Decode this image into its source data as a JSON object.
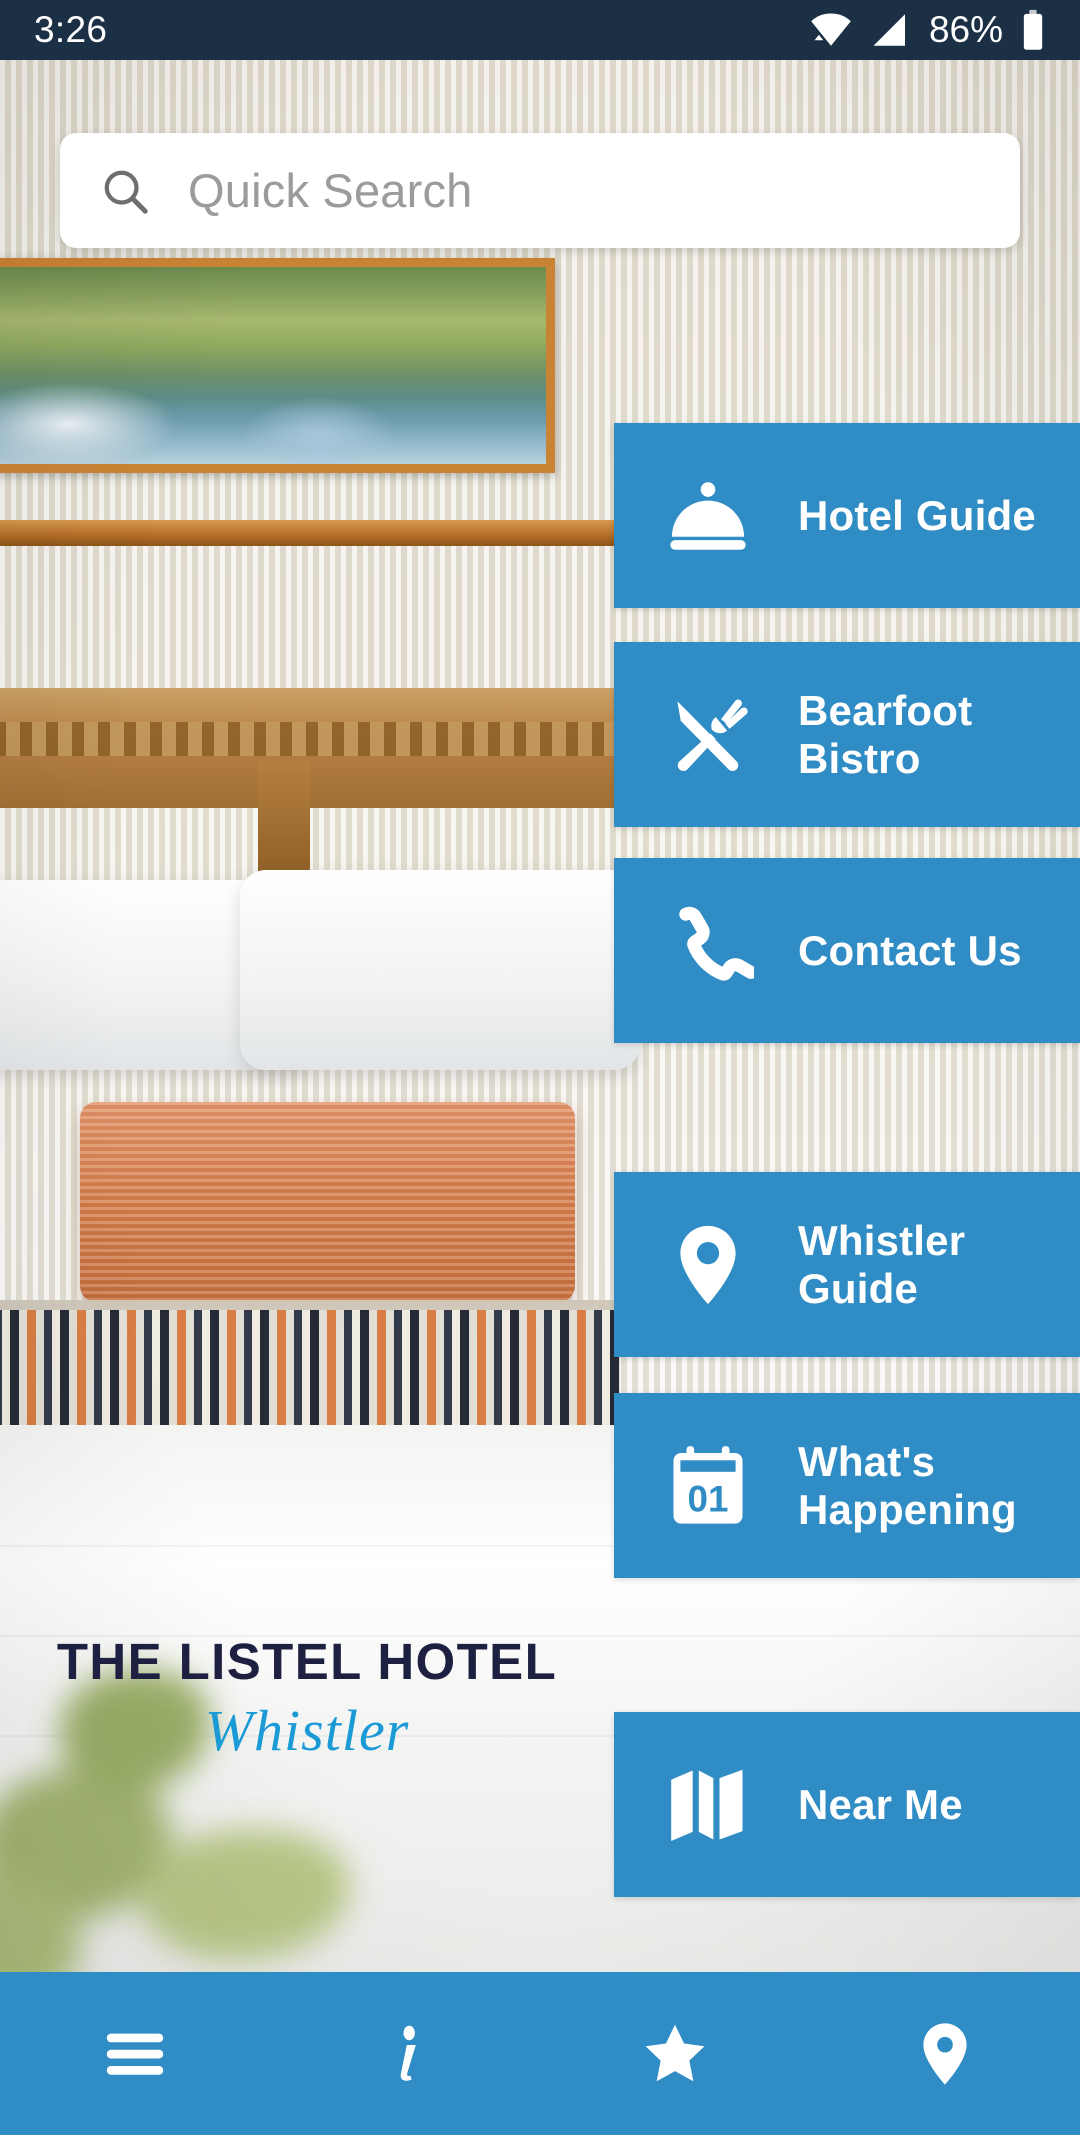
{
  "status_bar": {
    "time": "3:26",
    "battery_percent": "86%",
    "icons": [
      "wifi-icon",
      "cellular-signal-icon",
      "battery-icon"
    ]
  },
  "search": {
    "placeholder": "Quick Search",
    "value": "",
    "icon": "search-icon"
  },
  "menu": {
    "tiles": [
      {
        "label": "Hotel Guide",
        "line1": "Hotel Guide",
        "line2": "",
        "icon": "concierge-bell-icon"
      },
      {
        "label": "Bearfoot Bistro",
        "line1": "Bearfoot",
        "line2": "Bistro",
        "icon": "fork-knife-icon"
      },
      {
        "label": "Contact Us",
        "line1": "Contact Us",
        "line2": "",
        "icon": "phone-icon"
      },
      {
        "label": "Whistler Guide",
        "line1": "Whistler",
        "line2": "Guide",
        "icon": "map-pin-icon"
      },
      {
        "label": "What's Happening",
        "line1": "What's",
        "line2": "Happening",
        "icon": "calendar-icon",
        "icon_text": "01"
      },
      {
        "label": "Near Me",
        "line1": "Near Me",
        "line2": "",
        "icon": "folded-map-icon"
      }
    ]
  },
  "logo": {
    "name": "THE LISTEL HOTEL",
    "location": "Whistler"
  },
  "bottom_nav": {
    "items": [
      {
        "name": "menu",
        "icon": "hamburger-menu-icon"
      },
      {
        "name": "info",
        "icon": "info-icon"
      },
      {
        "name": "favorites",
        "icon": "star-icon"
      },
      {
        "name": "location",
        "icon": "location-pin-icon"
      }
    ]
  },
  "colors": {
    "tile_blue": "#2f8cc4",
    "status_bar": "#1b2f45",
    "logo_navy": "#1d2040",
    "logo_blue": "#1b9ad6"
  }
}
